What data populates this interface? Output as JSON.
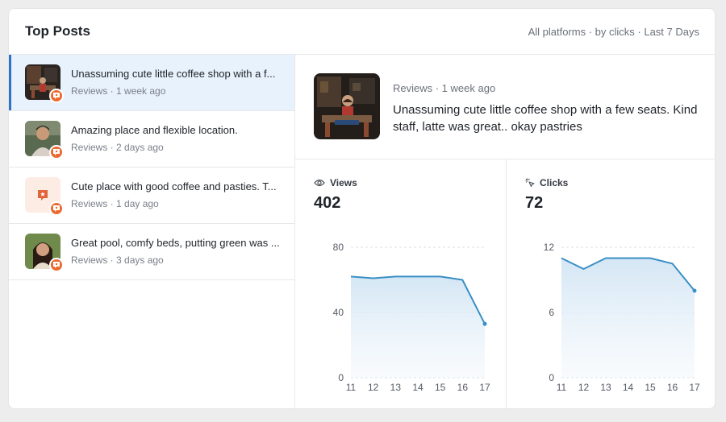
{
  "header": {
    "title": "Top Posts",
    "filter": "All platforms · by clicks · Last 7 Days"
  },
  "posts": [
    {
      "title": "Unassuming cute little coffee shop with a f...",
      "meta": "Reviews · 1 week ago",
      "thumb": "coffee-shop-photo",
      "active": true
    },
    {
      "title": "Amazing place and flexible location.",
      "meta": "Reviews · 2 days ago",
      "thumb": "man-portrait-photo",
      "active": false
    },
    {
      "title": "Cute place with good coffee and pasties. T...",
      "meta": "Reviews · 1 day ago",
      "thumb": "review-star-icon",
      "active": false
    },
    {
      "title": "Great pool, comfy beds, putting green was ...",
      "meta": "Reviews · 3 days ago",
      "thumb": "woman-portrait-photo",
      "active": false
    }
  ],
  "detail": {
    "meta": "Reviews · 1 week ago",
    "body": "Unassuming cute little coffee shop with a few seats. Kind staff, latte was great.. okay pastries"
  },
  "metrics": {
    "views": {
      "label": "Views",
      "value": "402",
      "icon": "eye-icon"
    },
    "clicks": {
      "label": "Clicks",
      "value": "72",
      "icon": "cursor-click-icon"
    }
  },
  "colors": {
    "accent": "#2f73c0",
    "badge": "#ea6a2f",
    "line": "#3a8fc4",
    "active_bg": "#e8f2fc"
  },
  "chart_data": [
    {
      "type": "area",
      "x": [
        "11",
        "12",
        "13",
        "14",
        "15",
        "16",
        "17"
      ],
      "values": [
        62,
        61,
        62,
        62,
        62,
        60,
        33
      ],
      "yticks": [
        0,
        40,
        80
      ],
      "ylim": [
        0,
        80
      ]
    },
    {
      "type": "area",
      "x": [
        "11",
        "12",
        "13",
        "14",
        "15",
        "16",
        "17"
      ],
      "values": [
        11,
        10,
        11,
        11,
        11,
        10.5,
        8
      ],
      "yticks": [
        0,
        6,
        12
      ],
      "ylim": [
        0,
        12
      ]
    }
  ]
}
